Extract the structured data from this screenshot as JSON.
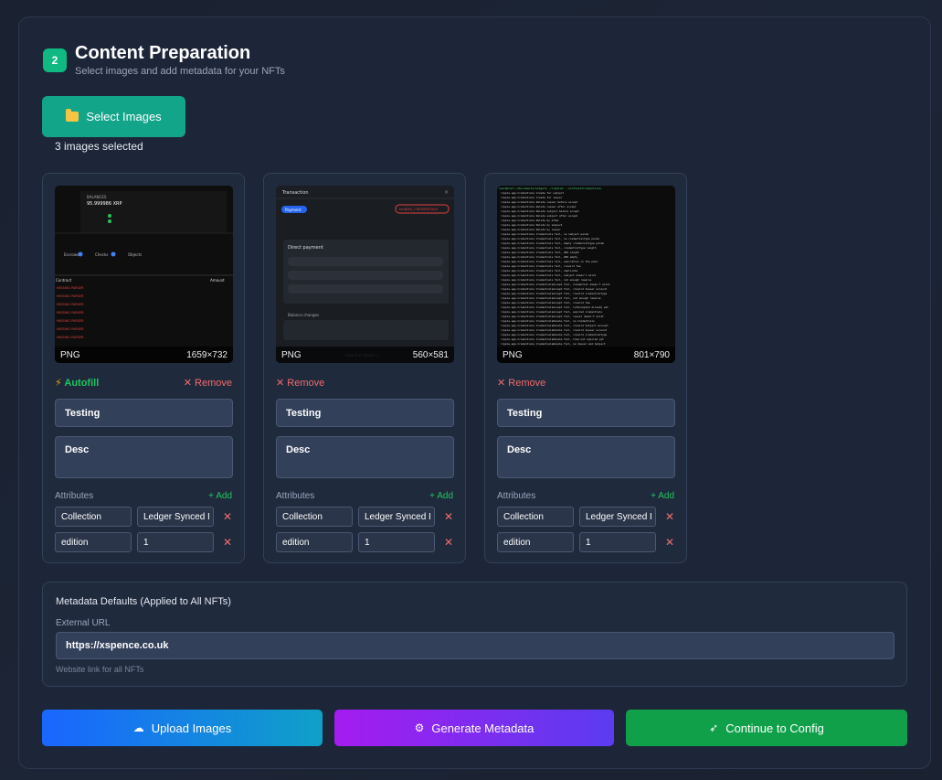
{
  "step": {
    "number": "2",
    "title": "Content Preparation",
    "subtitle": "Select images and add metadata for your NFTs"
  },
  "select_button": {
    "label": "Select Images",
    "icon": "folder-icon"
  },
  "selection_status": "3 images selected",
  "cards": [
    {
      "format": "PNG",
      "dimensions": "1659×732",
      "autofill_label": "Autofill",
      "remove_label": "✕ Remove",
      "name_value": "Testing",
      "desc_value": "Desc",
      "attributes_label": "Attributes",
      "add_label": "+ Add",
      "attributes": [
        {
          "key": "Collection",
          "value": "Ledger Synced I"
        },
        {
          "key": "edition",
          "value": "1"
        }
      ]
    },
    {
      "format": "PNG",
      "dimensions": "560×581",
      "remove_label": "✕ Remove",
      "name_value": "Testing",
      "desc_value": "Desc",
      "attributes_label": "Attributes",
      "add_label": "+ Add",
      "attributes": [
        {
          "key": "Collection",
          "value": "Ledger Synced I"
        },
        {
          "key": "edition",
          "value": "1"
        }
      ]
    },
    {
      "format": "PNG",
      "dimensions": "801×790",
      "remove_label": "✕ Remove",
      "name_value": "Testing",
      "desc_value": "Desc",
      "attributes_label": "Attributes",
      "add_label": "+ Add",
      "attributes": [
        {
          "key": "Collection",
          "value": "Ledger Synced I"
        },
        {
          "key": "edition",
          "value": "1"
        }
      ]
    }
  ],
  "metadata_defaults": {
    "title": "Metadata Defaults (Applied to All NFTs)",
    "external_url_label": "External URL",
    "external_url_value": "https://xspence.co.uk",
    "help_text": "Website link for all NFTs"
  },
  "actions": {
    "upload_label": "Upload Images",
    "generate_label": "Generate Metadata",
    "continue_label": "Continue to Config"
  },
  "colors": {
    "accent_green": "#10b981",
    "remove_red": "#f26b6b"
  }
}
